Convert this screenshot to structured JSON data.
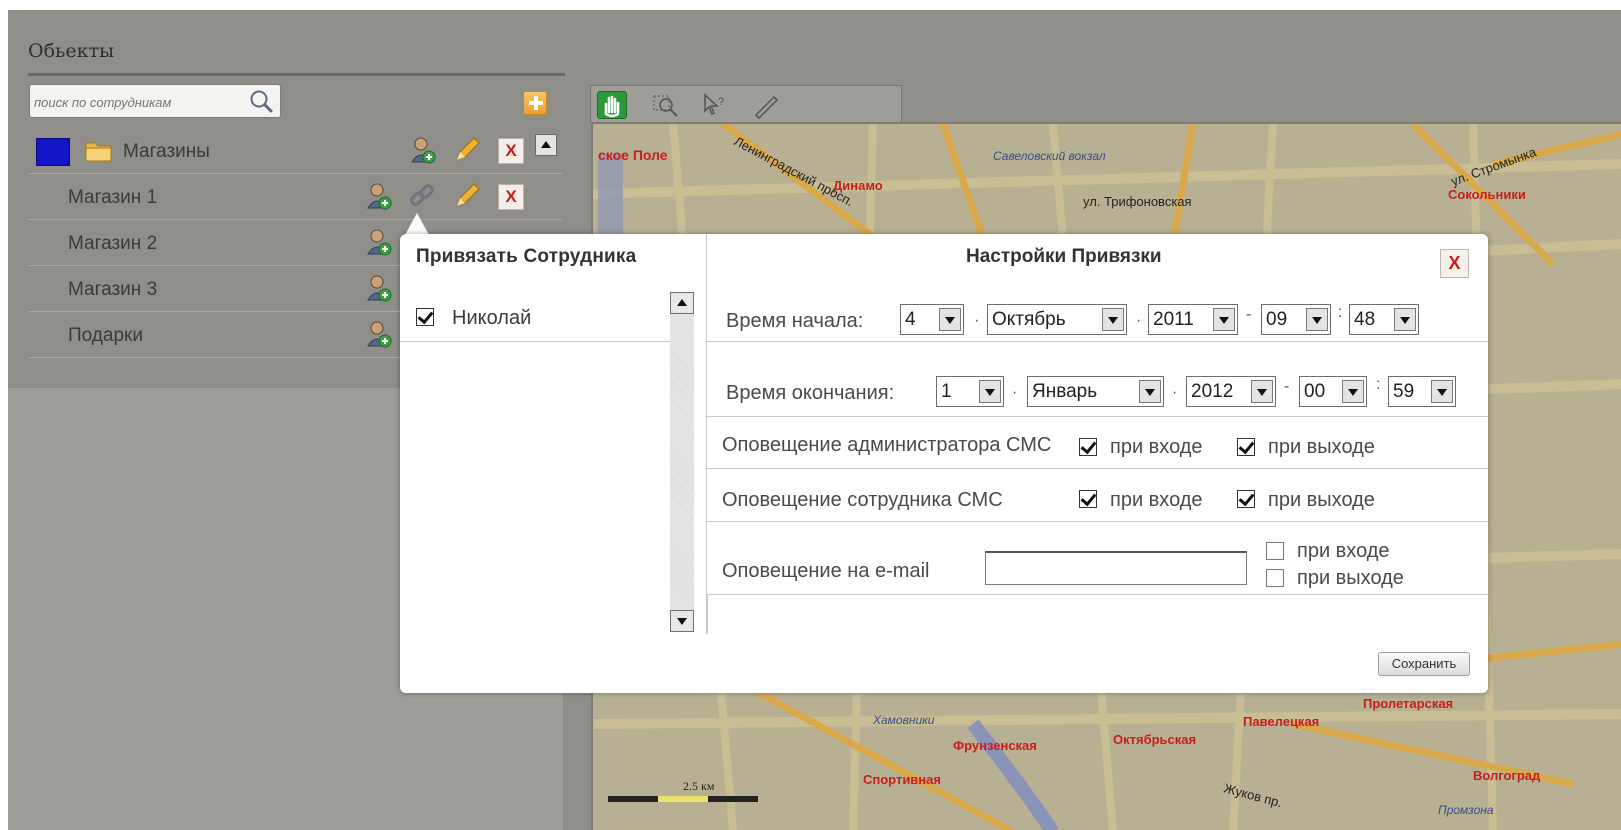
{
  "panel": {
    "title": "Обьекты",
    "search_placeholder": "поиск по сотрудникам",
    "tree": [
      {
        "label": "Магазины",
        "type": "group",
        "swatch_color": "#1515c8"
      },
      {
        "label": "Магазин 1",
        "type": "item"
      },
      {
        "label": "Магазин 2",
        "type": "item"
      },
      {
        "label": "Магазин 3",
        "type": "item"
      },
      {
        "label": "Подарки",
        "type": "item"
      }
    ]
  },
  "map": {
    "labels": [
      "ское Поле",
      "Динамо",
      "Савеловский вокзал",
      "ул. Трифоновская",
      "Ленинградский просп.",
      "ул. Стромынка",
      "Сокольники",
      "Хамовники",
      "Фрунзенская",
      "Октябрьская",
      "Павелецкая",
      "Пролетарская",
      "Спортивная",
      "Жуков пр.",
      "Волгоград",
      "Промзона"
    ],
    "scale": "2.5 км"
  },
  "dialog": {
    "left_title": "Привязать Сотрудника",
    "employees": [
      {
        "name": "Николай",
        "checked": true
      }
    ],
    "right_title": "Настройки Привязки",
    "close_label": "X",
    "start_label": "Время начала:",
    "start": {
      "day": "4",
      "month": "Октябрь",
      "year": "2011",
      "hour": "09",
      "minute": "48"
    },
    "end_label": "Время окончания:",
    "end": {
      "day": "1",
      "month": "Январь",
      "year": "2012",
      "hour": "00",
      "minute": "59"
    },
    "admin_sms_label": "Оповещение администратора СМС",
    "admin_sms_on_enter": true,
    "admin_sms_on_exit": true,
    "employee_sms_label": "Оповещение сотрудника СМС",
    "employee_sms_on_enter": true,
    "employee_sms_on_exit": true,
    "email_label": "Оповещение на e-mail",
    "email_value": "",
    "email_on_enter": false,
    "email_on_exit": false,
    "on_enter_label": "при входе",
    "on_exit_label": "при выходе",
    "save_label": "Сохранить"
  }
}
